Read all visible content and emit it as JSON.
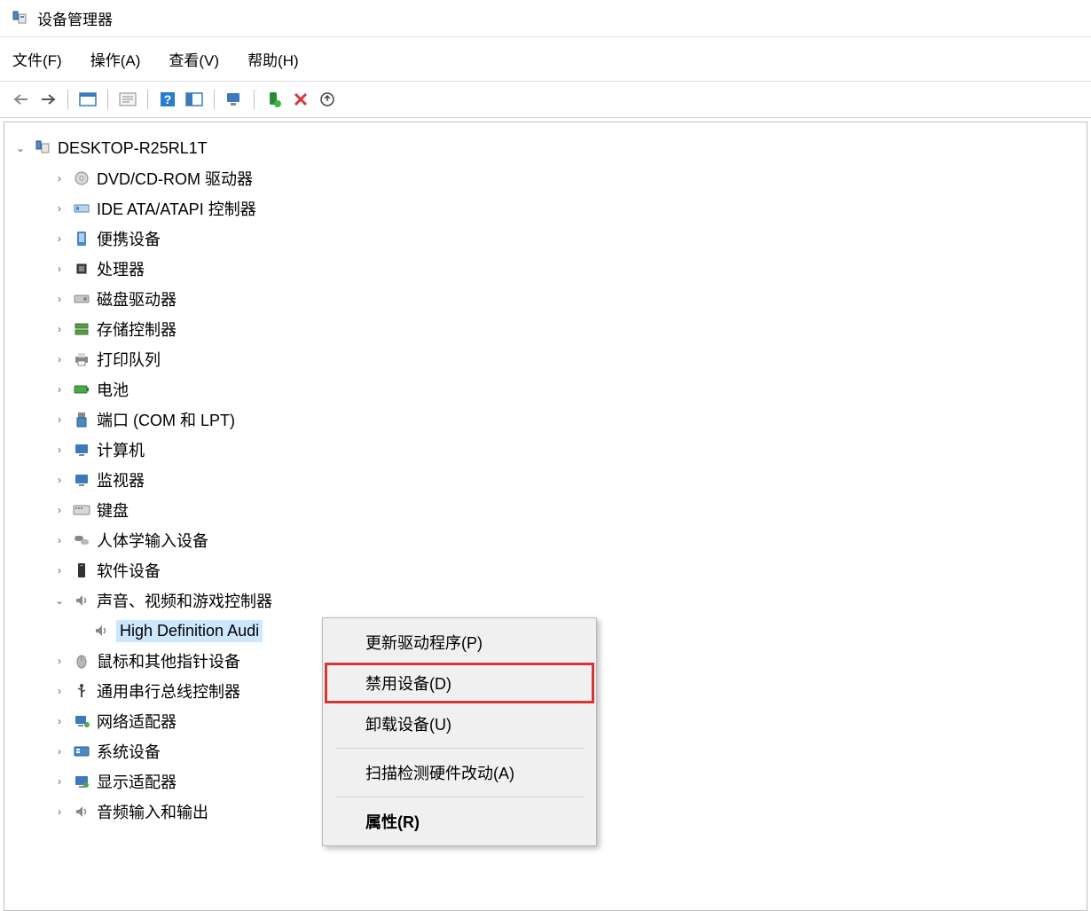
{
  "window": {
    "title": "设备管理器"
  },
  "menubar": {
    "file": "文件(F)",
    "action": "操作(A)",
    "view": "查看(V)",
    "help": "帮助(H)"
  },
  "tree": {
    "root": "DESKTOP-R25RL1T",
    "items": [
      {
        "label": "DVD/CD-ROM 驱动器",
        "icon": "disc",
        "expanded": false
      },
      {
        "label": "IDE ATA/ATAPI 控制器",
        "icon": "ide",
        "expanded": false
      },
      {
        "label": "便携设备",
        "icon": "portable",
        "expanded": false
      },
      {
        "label": "处理器",
        "icon": "cpu",
        "expanded": false
      },
      {
        "label": "磁盘驱动器",
        "icon": "disk",
        "expanded": false
      },
      {
        "label": "存储控制器",
        "icon": "storage",
        "expanded": false
      },
      {
        "label": "打印队列",
        "icon": "printer",
        "expanded": false
      },
      {
        "label": "电池",
        "icon": "battery",
        "expanded": false
      },
      {
        "label": "端口 (COM 和 LPT)",
        "icon": "port",
        "expanded": false
      },
      {
        "label": "计算机",
        "icon": "computer",
        "expanded": false
      },
      {
        "label": "监视器",
        "icon": "monitor",
        "expanded": false
      },
      {
        "label": "键盘",
        "icon": "keyboard",
        "expanded": false
      },
      {
        "label": "人体学输入设备",
        "icon": "hid",
        "expanded": false
      },
      {
        "label": "软件设备",
        "icon": "software",
        "expanded": false
      },
      {
        "label": "声音、视频和游戏控制器",
        "icon": "sound",
        "expanded": true
      },
      {
        "label": "鼠标和其他指针设备",
        "icon": "mouse",
        "expanded": false
      },
      {
        "label": "通用串行总线控制器",
        "icon": "usb",
        "expanded": false
      },
      {
        "label": "网络适配器",
        "icon": "network",
        "expanded": false
      },
      {
        "label": "系统设备",
        "icon": "system",
        "expanded": false
      },
      {
        "label": "显示适配器",
        "icon": "display",
        "expanded": false
      },
      {
        "label": "音频输入和输出",
        "icon": "audio",
        "expanded": false
      }
    ],
    "child_of_sound": "High Definition Audi"
  },
  "context_menu": {
    "update": "更新驱动程序(P)",
    "disable": "禁用设备(D)",
    "uninstall": "卸载设备(U)",
    "scan": "扫描检测硬件改动(A)",
    "properties": "属性(R)"
  }
}
